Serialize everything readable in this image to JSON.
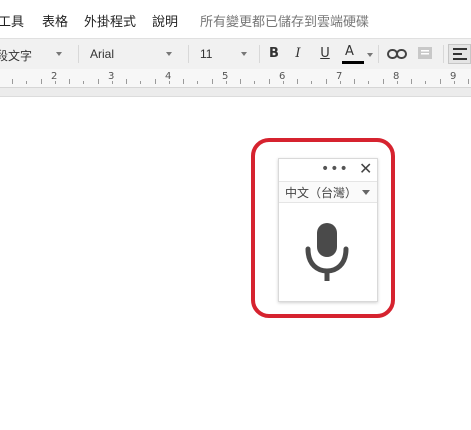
{
  "menubar": {
    "items": [
      "工具",
      "表格",
      "外掛程式",
      "說明"
    ],
    "save_status": "所有變更都已儲存到雲端硬碟"
  },
  "toolbar": {
    "style_value": "段文字",
    "font_value": "Arial",
    "size_value": "11",
    "bold": "B",
    "italic": "I",
    "underline": "U",
    "text_color": "A",
    "text_color_bar": "#000000"
  },
  "ruler": {
    "numbers": [
      "2",
      "3",
      "4",
      "5",
      "6",
      "7",
      "8",
      "9"
    ]
  },
  "voice_panel": {
    "dots": "•••",
    "close": "✕",
    "language": "中文（台灣）",
    "mic_icon": "microphone-icon"
  },
  "colors": {
    "highlight": "#d6232f",
    "mic": "#4a4a4a"
  }
}
